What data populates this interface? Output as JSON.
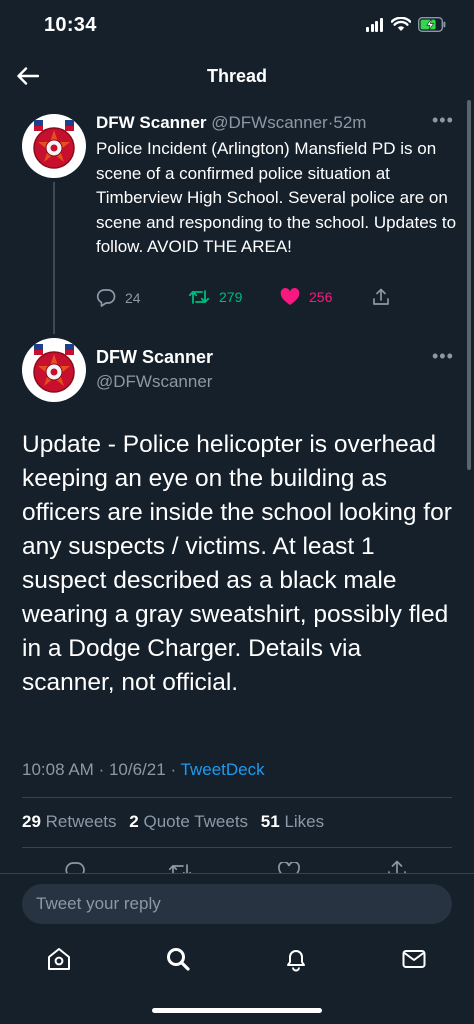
{
  "status_bar": {
    "time": "10:34"
  },
  "header": {
    "title": "Thread"
  },
  "tweet_parent": {
    "name": "DFW Scanner",
    "handle": "@DFWscanner",
    "separator": "·",
    "time": "52m",
    "text": "Police Incident (Arlington) Mansfield PD is on scene of a confirmed police situation at Timberview High School. Several police are on scene and responding to the school. Updates to follow. AVOID THE AREA!",
    "replies": "24",
    "retweets": "279",
    "likes": "256"
  },
  "tweet_main": {
    "name": "DFW Scanner",
    "handle": "@DFWscanner",
    "text": "Update - Police helicopter is overhead keeping an eye on the building as officers are inside the school looking for any suspects / victims. At least 1 suspect described as a black male wearing a gray sweatshirt, possibly fled in a Dodge Charger. Details via scanner, not official.",
    "time": "10:08 AM",
    "separator": "·",
    "date": "10/6/21",
    "source": "TweetDeck",
    "retweets_count": "29",
    "retweets_label": "Retweets",
    "quotes_count": "2",
    "quotes_label": "Quote Tweets",
    "likes_count": "51",
    "likes_label": "Likes"
  },
  "reply": {
    "placeholder": "Tweet your reply"
  },
  "colors": {
    "background": "#15202b",
    "muted": "#8b98a5",
    "accent": "#1d9bf0",
    "retweet": "#00ba7c",
    "like": "#f91880"
  },
  "icons": {
    "status": [
      "signal-icon",
      "wifi-icon",
      "battery-charging-icon"
    ],
    "actions": [
      "reply-icon",
      "retweet-icon",
      "like-icon",
      "share-icon"
    ],
    "nav": [
      "home-icon",
      "search-icon",
      "notifications-icon",
      "messages-icon"
    ]
  }
}
